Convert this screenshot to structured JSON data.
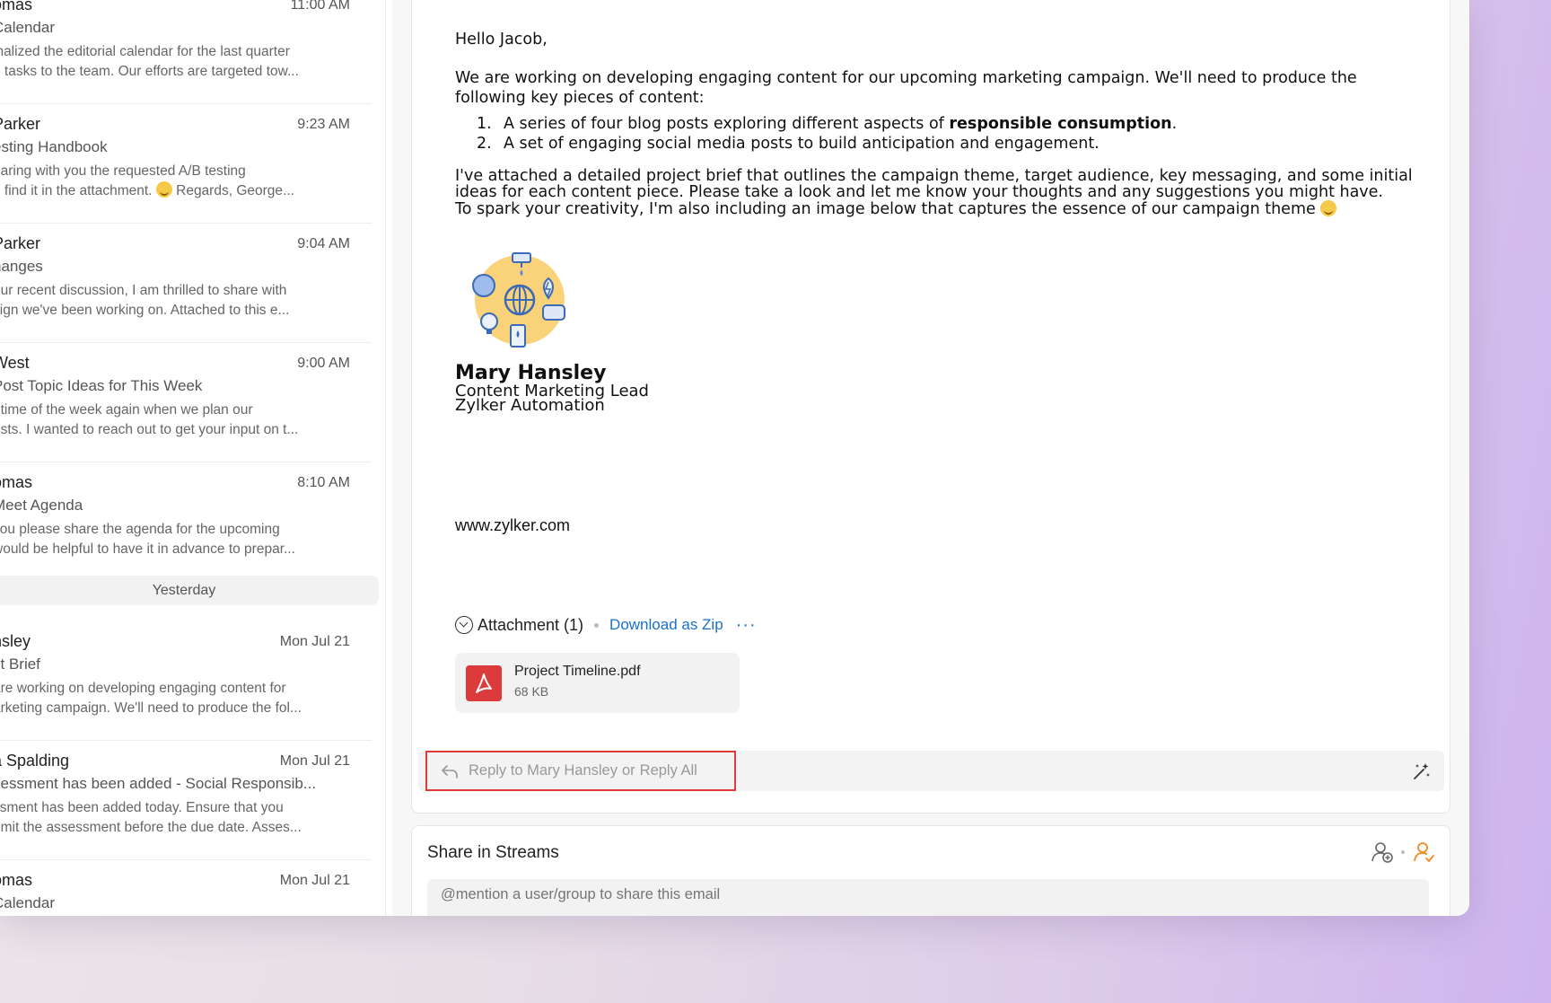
{
  "mail_list": {
    "items": [
      {
        "sender": "omas",
        "time": "11:00 AM",
        "subject": "Calendar",
        "preview_line1": "inalized the editorial calendar for the last quarter",
        "preview_line2": "e tasks to the team. Our efforts are targeted tow..."
      },
      {
        "sender": "Parker",
        "time": "9:23 AM",
        "subject": "esting Handbook",
        "preview_line1": "haring with you the requested A/B testing",
        "preview_line2": "e find it in the attachment.",
        "preview_line2b": "Regards, George..."
      },
      {
        "sender": "Parker",
        "time": "9:04 AM",
        "subject": "hanges",
        "preview_line1": "our recent discussion, I am thrilled to share with",
        "preview_line2": "sign we've been working on. Attached to this e..."
      },
      {
        "sender": "West",
        "time": "9:00 AM",
        "subject": "Post Topic Ideas for This Week",
        "preview_line1": "t time of the week again when we plan our",
        "preview_line2": "osts. I wanted to reach out to get your input on t..."
      },
      {
        "sender": "omas",
        "time": "8:10 AM",
        "subject": "Meet Agenda",
        "preview_line1": "you please share the agenda for the upcoming",
        "preview_line2": "would be helpful to have it in advance to prepar..."
      },
      {
        "sender": "nsley",
        "time": "Mon Jul 21",
        "subject": "ct Brief",
        "preview_line1": "are working on developing engaging content for",
        "preview_line2": "arketing campaign. We'll need to produce the fol..."
      },
      {
        "sender": "a Spalding",
        "time": "Mon Jul 21",
        "subject": "sessment has been added - Social Responsib...",
        "preview_line1": "ssment has been added today. Ensure that you",
        "preview_line2": "bmit the assessment before the due date. Asses..."
      },
      {
        "sender": "omas",
        "time": "Mon Jul 21",
        "subject": "Calendar",
        "preview_line1": "",
        "preview_line2": ""
      }
    ],
    "date_separator": "Yesterday"
  },
  "email": {
    "greeting": "Hello Jacob,",
    "para1": "We are working on developing engaging content for our upcoming marketing campaign. We'll need to produce the following key pieces of content:",
    "list": [
      {
        "num": "1.",
        "before": "A series of four blog posts exploring different aspects of ",
        "bold": "responsible consumption",
        "after": "."
      },
      {
        "num": "2.",
        "before": "A set of engaging social media posts to build anticipation and engagement.",
        "bold": "",
        "after": ""
      }
    ],
    "para2_line1": "I've attached a detailed project brief that outlines the campaign theme, target audience, key messaging, and some initial",
    "para2_line2": "ideas for each content piece. Please take a look and let me know your thoughts and any suggestions you might have.",
    "para2_line3": "To spark your creativity, I'm also including an image below that captures the essence of our campaign theme",
    "signature": {
      "name": "Mary Hansley",
      "role": "Content Marketing Lead",
      "company": "Zylker Automation",
      "website": "www.zylker.com"
    },
    "attachments": {
      "title": "Attachment (1)",
      "download_zip": "Download as Zip",
      "more": "···",
      "files": [
        {
          "name": "Project Timeline.pdf",
          "size": "68 KB"
        }
      ]
    }
  },
  "reply": {
    "reply_to": "Reply to Mary Hansley",
    "or": "or",
    "reply_all": "Reply All"
  },
  "streams": {
    "title": "Share in Streams",
    "placeholder": "@mention a user/group to share this email"
  },
  "colors": {
    "accent_blue": "#1a6fcf",
    "highlight_red": "#e23b3b",
    "pdf_red": "#dd3b3b",
    "orange": "#f08a24"
  }
}
